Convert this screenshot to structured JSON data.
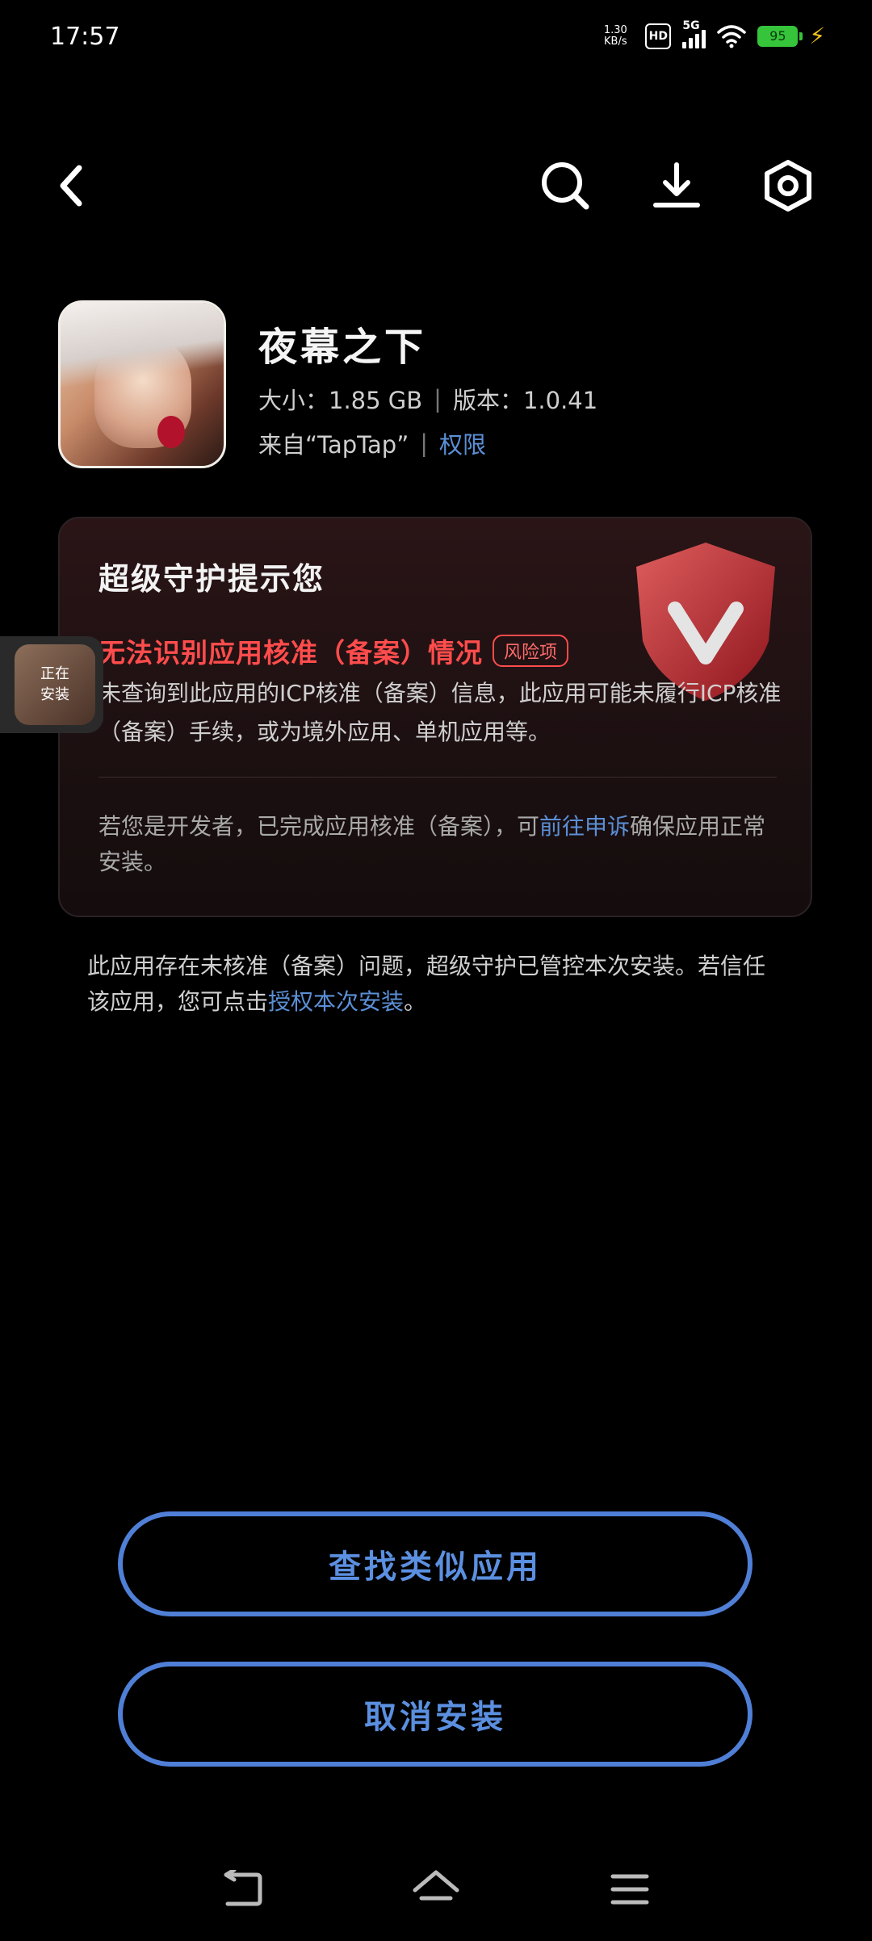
{
  "status_bar": {
    "time": "17:57",
    "net_speed_value": "1.30",
    "net_speed_unit": "KB/s",
    "hd": "HD",
    "signal": "5G",
    "battery": "95"
  },
  "app": {
    "name": "夜幕之下",
    "size_label": "大小：",
    "size_value": "1.85 GB",
    "version_label": "版本：",
    "version_value": "1.0.41",
    "source": "来自“TapTap”",
    "permission_link": "权限"
  },
  "guard": {
    "title": "超级守护提示您",
    "risk_title": "无法识别应用核准（备案）情况",
    "risk_badge": "风险项",
    "risk_desc": "未查询到此应用的ICP核准（备案）信息，此应用可能未履行ICP核准（备案）手续，或为境外应用、单机应用等。",
    "dev_note_prefix": "若您是开发者，已完成应用核准（备案），可",
    "dev_note_link": "前往申诉",
    "dev_note_suffix": "确保应用正常安装。"
  },
  "footer": {
    "prefix": "此应用存在未核准（备案）问题，超级守护已管控本次安装。若信任该应用，您可点击",
    "link": "授权本次安装",
    "suffix": "。"
  },
  "installing_bubble": {
    "line1": "正在",
    "line2": "安装"
  },
  "buttons": {
    "find_similar": "查找类似应用",
    "cancel_install": "取消安装"
  },
  "colors": {
    "accent_blue": "#5b8fe0",
    "risk_red": "#ff4c4c",
    "battery_green": "#36c43a"
  }
}
